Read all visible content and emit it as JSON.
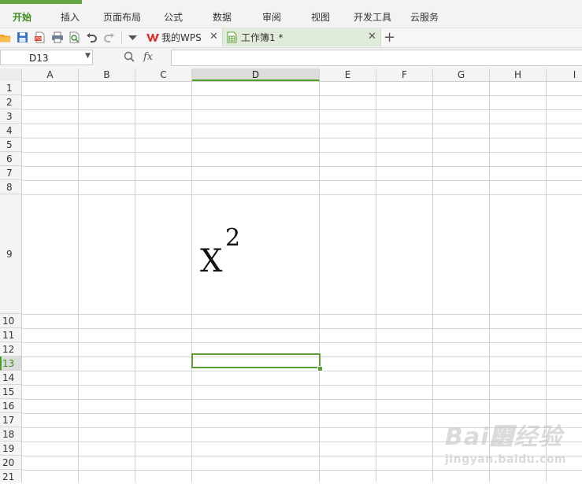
{
  "menu": {
    "items": [
      "开始",
      "插入",
      "页面布局",
      "公式",
      "数据",
      "审阅",
      "视图",
      "开发工具",
      "云服务"
    ],
    "active_index": 0,
    "accent_color": "#65a843"
  },
  "toolbar": {
    "icons": [
      "open-folder-icon",
      "save-icon",
      "export-pdf-icon",
      "print-icon",
      "print-preview-icon",
      "undo-icon",
      "redo-icon",
      "dropdown-arrow-icon"
    ]
  },
  "tabs": [
    {
      "label": "我的WPS",
      "icon": "wps-logo-icon",
      "active": false
    },
    {
      "label": "工作簿1 *",
      "icon": "spreadsheet-doc-icon",
      "active": true
    }
  ],
  "formula_bar": {
    "name_box": "D13",
    "fx_label": "fx",
    "formula": ""
  },
  "grid": {
    "columns": [
      "A",
      "B",
      "C",
      "D",
      "E",
      "F",
      "G",
      "H",
      "I"
    ],
    "rows": [
      "1",
      "2",
      "3",
      "4",
      "5",
      "6",
      "7",
      "8",
      "9",
      "10",
      "11",
      "12",
      "13",
      "14",
      "15",
      "16",
      "17",
      "18",
      "19",
      "20",
      "21"
    ],
    "selected_cell": "D13",
    "selected_column": "D",
    "selected_row": "13"
  },
  "cell_content": {
    "address": "D9",
    "base": "X",
    "superscript": "2"
  },
  "watermark": {
    "main": "Bai୾经验",
    "sub": "jingyan.baidu.com"
  }
}
